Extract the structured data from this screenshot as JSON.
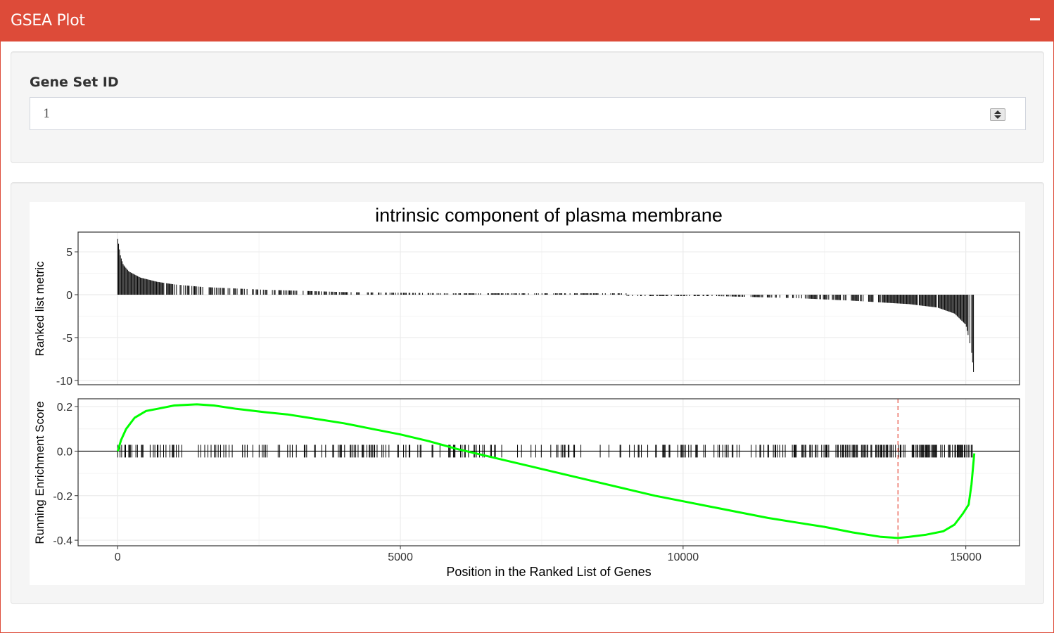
{
  "header": {
    "title": "GSEA Plot"
  },
  "input": {
    "label": "Gene Set ID",
    "value": "1"
  },
  "colors": {
    "header": "#dd4b39",
    "running_score": "#00ff00",
    "peak_line": "#e74c3c"
  },
  "icons": {
    "collapse": "minus-icon",
    "spinner": "spinner-arrows-icon"
  },
  "chart_data": {
    "title": "intrinsic component of plasma membrane",
    "xlabel": "Position in the Ranked List of Genes",
    "x_ticks": [
      0,
      5000,
      10000,
      15000
    ],
    "xlim": [
      -700,
      15950
    ],
    "grid": true,
    "panels": [
      {
        "type": "bar",
        "ylabel": "Ranked list metric",
        "ylim": [
          -10.5,
          7.3
        ],
        "y_ticks": [
          5,
          0,
          -5,
          -10
        ],
        "metric_curve": [
          [
            0,
            6.5
          ],
          [
            20,
            5.8
          ],
          [
            50,
            4.5
          ],
          [
            100,
            3.5
          ],
          [
            200,
            2.7
          ],
          [
            400,
            2.0
          ],
          [
            700,
            1.5
          ],
          [
            1000,
            1.2
          ],
          [
            1500,
            0.9
          ],
          [
            2500,
            0.6
          ],
          [
            4000,
            0.3
          ],
          [
            6000,
            0.15
          ],
          [
            8000,
            0.05
          ],
          [
            9000,
            0.0
          ],
          [
            10500,
            -0.15
          ],
          [
            12000,
            -0.4
          ],
          [
            13000,
            -0.7
          ],
          [
            14000,
            -1.1
          ],
          [
            14500,
            -1.5
          ],
          [
            14800,
            -2.2
          ],
          [
            15000,
            -3.5
          ],
          [
            15100,
            -6.5
          ],
          [
            15150,
            -10.0
          ]
        ]
      },
      {
        "type": "line",
        "ylabel": "Running Enrichment Score",
        "ylim": [
          -0.425,
          0.235
        ],
        "y_ticks": [
          0.2,
          0.0,
          -0.2,
          -0.4
        ],
        "series": [
          {
            "x": [
              0,
              60,
              150,
              300,
              500,
              700,
              1000,
              1400,
              1700,
              2100,
              2600,
              3000,
              3500,
              4000,
              4500,
              5000,
              5500,
              6000,
              6500,
              7000,
              7500,
              8000,
              8500,
              9000,
              9500,
              10000,
              10500,
              11000,
              11500,
              12000,
              12500,
              13000,
              13500,
              13800,
              14000,
              14300,
              14600,
              14800,
              14950,
              15050,
              15100,
              15150
            ],
            "y": [
              0.0,
              0.05,
              0.1,
              0.15,
              0.18,
              0.19,
              0.205,
              0.21,
              0.205,
              0.19,
              0.175,
              0.165,
              0.145,
              0.125,
              0.1,
              0.075,
              0.045,
              0.01,
              -0.02,
              -0.05,
              -0.08,
              -0.11,
              -0.14,
              -0.17,
              -0.2,
              -0.225,
              -0.25,
              -0.275,
              -0.3,
              -0.32,
              -0.34,
              -0.365,
              -0.385,
              -0.39,
              -0.385,
              -0.375,
              -0.36,
              -0.33,
              -0.28,
              -0.24,
              -0.15,
              -0.01
            ]
          }
        ],
        "hits": [
          [
            0,
            1900,
            0.28
          ],
          [
            1900,
            3300,
            0.2
          ],
          [
            3300,
            5000,
            0.32
          ],
          [
            5000,
            6400,
            0.26
          ],
          [
            6400,
            8200,
            0.2
          ],
          [
            8450,
            10000,
            0.2
          ],
          [
            10000,
            13000,
            0.24
          ],
          [
            13000,
            15150,
            0.5
          ]
        ],
        "peak_x": 13800
      }
    ]
  }
}
